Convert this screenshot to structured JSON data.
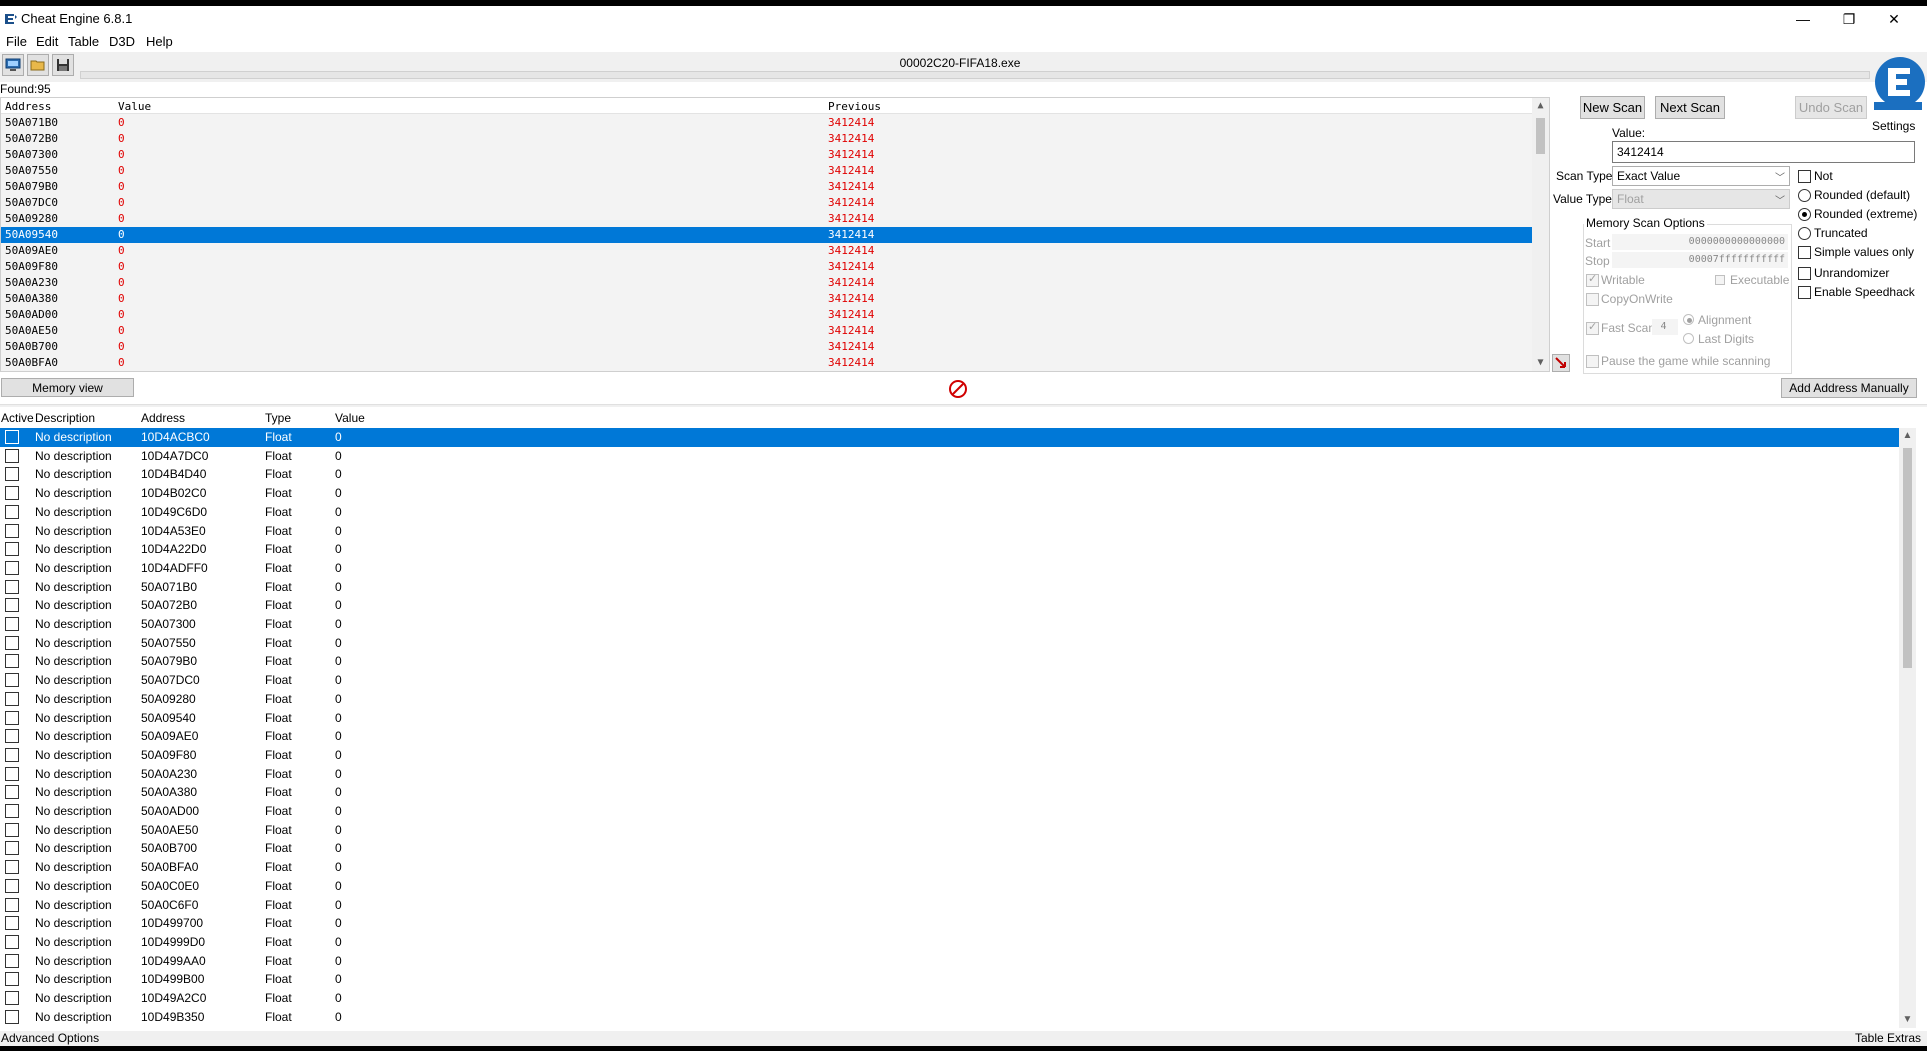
{
  "window": {
    "title": "Cheat Engine 6.8.1",
    "minimize": "—",
    "restore": "❐",
    "close": "✕"
  },
  "menu": [
    "File",
    "Edit",
    "Table",
    "D3D",
    "Help"
  ],
  "process_name": "00002C20-FIFA18.exe",
  "found_label": "Found:95",
  "settings_label": "Settings",
  "results": {
    "headers": {
      "address": "Address",
      "value": "Value",
      "previous": "Previous"
    },
    "rows": [
      {
        "address": "50A071B0",
        "value": "0",
        "previous": "3412414"
      },
      {
        "address": "50A072B0",
        "value": "0",
        "previous": "3412414"
      },
      {
        "address": "50A07300",
        "value": "0",
        "previous": "3412414"
      },
      {
        "address": "50A07550",
        "value": "0",
        "previous": "3412414"
      },
      {
        "address": "50A079B0",
        "value": "0",
        "previous": "3412414"
      },
      {
        "address": "50A07DC0",
        "value": "0",
        "previous": "3412414"
      },
      {
        "address": "50A09280",
        "value": "0",
        "previous": "3412414"
      },
      {
        "address": "50A09540",
        "value": "0",
        "previous": "3412414"
      },
      {
        "address": "50A09AE0",
        "value": "0",
        "previous": "3412414"
      },
      {
        "address": "50A09F80",
        "value": "0",
        "previous": "3412414"
      },
      {
        "address": "50A0A230",
        "value": "0",
        "previous": "3412414"
      },
      {
        "address": "50A0A380",
        "value": "0",
        "previous": "3412414"
      },
      {
        "address": "50A0AD00",
        "value": "0",
        "previous": "3412414"
      },
      {
        "address": "50A0AE50",
        "value": "0",
        "previous": "3412414"
      },
      {
        "address": "50A0B700",
        "value": "0",
        "previous": "3412414"
      },
      {
        "address": "50A0BFA0",
        "value": "0",
        "previous": "3412414"
      }
    ],
    "selected_index": 7
  },
  "scan": {
    "new_scan": "New Scan",
    "next_scan": "Next Scan",
    "undo_scan": "Undo Scan",
    "value_label": "Value:",
    "value": "3412414",
    "scan_type_label": "Scan Type",
    "scan_type": "Exact Value",
    "value_type_label": "Value Type",
    "value_type": "Float",
    "options": {
      "not": "Not",
      "rounded_default": "Rounded (default)",
      "rounded_extreme": "Rounded (extreme)",
      "truncated": "Truncated",
      "simple_values_only": "Simple values only",
      "unrandomizer": "Unrandomizer",
      "enable_speedhack": "Enable Speedhack"
    },
    "memory": {
      "title": "Memory Scan Options",
      "start_label": "Start",
      "start": "0000000000000000",
      "stop_label": "Stop",
      "stop": "00007fffffffffff",
      "writable": "Writable",
      "executable": "Executable",
      "copyonwrite": "CopyOnWrite",
      "fast_scan": "Fast Scan",
      "fast_scan_value": "4",
      "alignment": "Alignment",
      "last_digits": "Last Digits",
      "pause": "Pause the game while scanning"
    }
  },
  "memory_view_label": "Memory view",
  "add_address_label": "Add Address Manually",
  "addrlist": {
    "headers": {
      "active": "Active",
      "description": "Description",
      "address": "Address",
      "type": "Type",
      "value": "Value"
    },
    "rows": [
      {
        "d": "No description",
        "a": "10D4ACBC0",
        "t": "Float",
        "v": "0"
      },
      {
        "d": "No description",
        "a": "10D4A7DC0",
        "t": "Float",
        "v": "0"
      },
      {
        "d": "No description",
        "a": "10D4B4D40",
        "t": "Float",
        "v": "0"
      },
      {
        "d": "No description",
        "a": "10D4B02C0",
        "t": "Float",
        "v": "0"
      },
      {
        "d": "No description",
        "a": "10D49C6D0",
        "t": "Float",
        "v": "0"
      },
      {
        "d": "No description",
        "a": "10D4A53E0",
        "t": "Float",
        "v": "0"
      },
      {
        "d": "No description",
        "a": "10D4A22D0",
        "t": "Float",
        "v": "0"
      },
      {
        "d": "No description",
        "a": "10D4ADFF0",
        "t": "Float",
        "v": "0"
      },
      {
        "d": "No description",
        "a": "50A071B0",
        "t": "Float",
        "v": "0"
      },
      {
        "d": "No description",
        "a": "50A072B0",
        "t": "Float",
        "v": "0"
      },
      {
        "d": "No description",
        "a": "50A07300",
        "t": "Float",
        "v": "0"
      },
      {
        "d": "No description",
        "a": "50A07550",
        "t": "Float",
        "v": "0"
      },
      {
        "d": "No description",
        "a": "50A079B0",
        "t": "Float",
        "v": "0"
      },
      {
        "d": "No description",
        "a": "50A07DC0",
        "t": "Float",
        "v": "0"
      },
      {
        "d": "No description",
        "a": "50A09280",
        "t": "Float",
        "v": "0"
      },
      {
        "d": "No description",
        "a": "50A09540",
        "t": "Float",
        "v": "0"
      },
      {
        "d": "No description",
        "a": "50A09AE0",
        "t": "Float",
        "v": "0"
      },
      {
        "d": "No description",
        "a": "50A09F80",
        "t": "Float",
        "v": "0"
      },
      {
        "d": "No description",
        "a": "50A0A230",
        "t": "Float",
        "v": "0"
      },
      {
        "d": "No description",
        "a": "50A0A380",
        "t": "Float",
        "v": "0"
      },
      {
        "d": "No description",
        "a": "50A0AD00",
        "t": "Float",
        "v": "0"
      },
      {
        "d": "No description",
        "a": "50A0AE50",
        "t": "Float",
        "v": "0"
      },
      {
        "d": "No description",
        "a": "50A0B700",
        "t": "Float",
        "v": "0"
      },
      {
        "d": "No description",
        "a": "50A0BFA0",
        "t": "Float",
        "v": "0"
      },
      {
        "d": "No description",
        "a": "50A0C0E0",
        "t": "Float",
        "v": "0"
      },
      {
        "d": "No description",
        "a": "50A0C6F0",
        "t": "Float",
        "v": "0"
      },
      {
        "d": "No description",
        "a": "10D499700",
        "t": "Float",
        "v": "0"
      },
      {
        "d": "No description",
        "a": "10D4999D0",
        "t": "Float",
        "v": "0"
      },
      {
        "d": "No description",
        "a": "10D499AA0",
        "t": "Float",
        "v": "0"
      },
      {
        "d": "No description",
        "a": "10D499B00",
        "t": "Float",
        "v": "0"
      },
      {
        "d": "No description",
        "a": "10D49A2C0",
        "t": "Float",
        "v": "0"
      },
      {
        "d": "No description",
        "a": "10D49B350",
        "t": "Float",
        "v": "0"
      }
    ],
    "selected_index": 0
  },
  "status": {
    "advanced_options": "Advanced Options",
    "table_extras": "Table Extras"
  },
  "colors": {
    "selection": "#0078d7",
    "value_red": "#e00000"
  }
}
